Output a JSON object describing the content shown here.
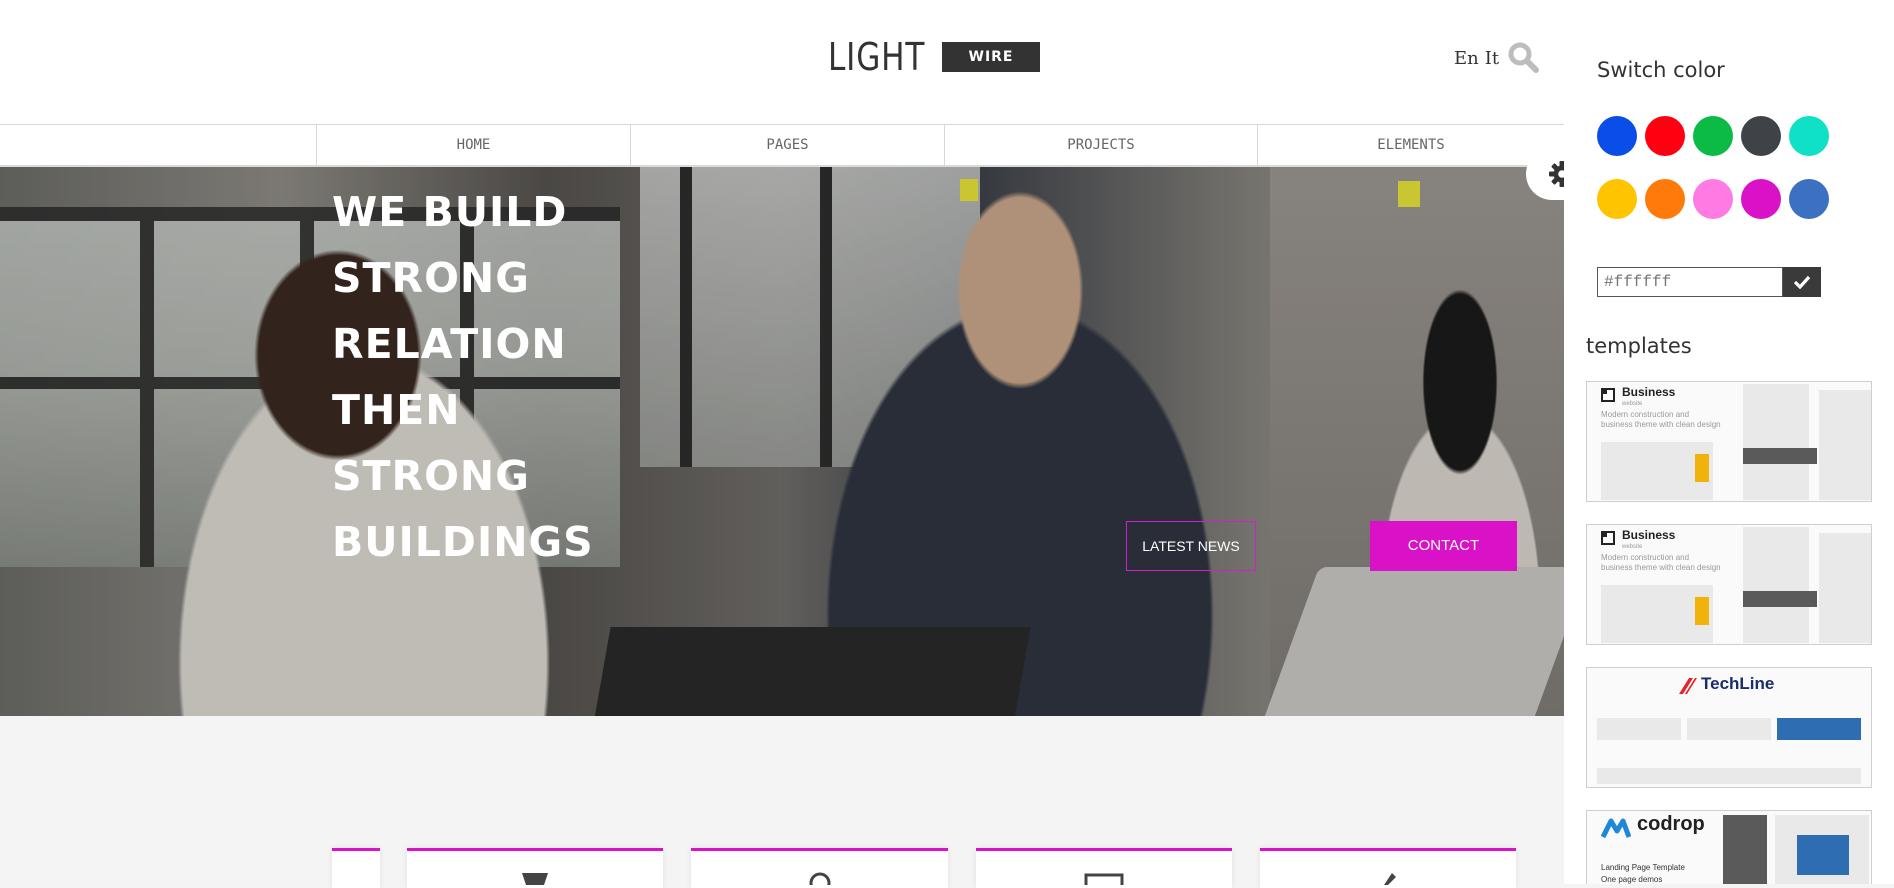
{
  "header": {
    "logo_main": "LIGHT",
    "logo_tag": "WIRE",
    "languages": [
      "En",
      "It"
    ]
  },
  "nav": {
    "items": [
      {
        "label": "HOME"
      },
      {
        "label": "PAGES"
      },
      {
        "label": "PROJECTS"
      },
      {
        "label": "ELEMENTS"
      }
    ]
  },
  "hero": {
    "title_lines": [
      "WE BUILD",
      "STRONG",
      "RELATION",
      "THEN",
      "STRONG",
      "BUILDINGS"
    ],
    "latest_news_label": "LATEST NEWS",
    "contact_label": "CONTACT"
  },
  "panel": {
    "switch_color_title": "Switch color",
    "swatches": [
      "#0a4de8",
      "#ff0010",
      "#0cbb45",
      "#3f4347",
      "#0ee1c6",
      "#ffc400",
      "#ff7a0a",
      "#ff7ae3",
      "#d912c8",
      "#3c70c0"
    ],
    "color_input_value": "#ffffff",
    "templates_title": "templates",
    "templates": [
      {
        "brand": "Business",
        "brand_sub": "website",
        "desc": "Modern construction and business theme with clean design"
      },
      {
        "brand": "Business",
        "brand_sub": "website",
        "desc": "Modern construction and business theme with clean design"
      },
      {
        "brand": "TechLine"
      },
      {
        "brand": "codrop",
        "lines": [
          "Landing Page Template",
          "One page demos"
        ]
      }
    ]
  },
  "colors": {
    "accent": "#d912c8",
    "dark": "#333333"
  }
}
